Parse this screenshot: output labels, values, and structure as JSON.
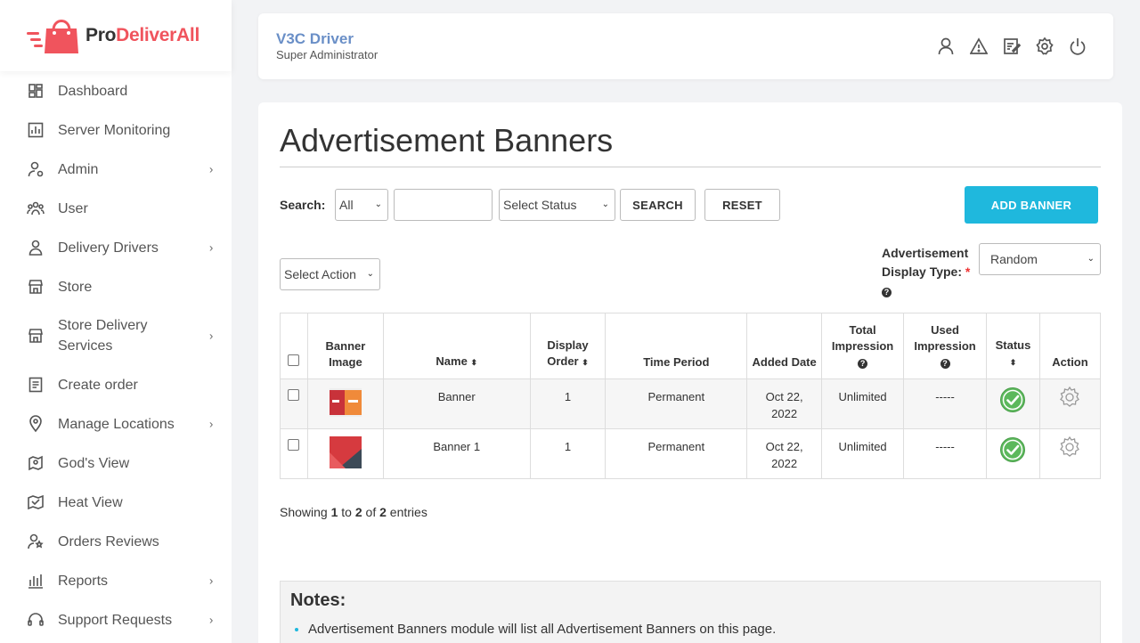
{
  "brand": {
    "part1": "Pro",
    "part2": "DeliverAll"
  },
  "sidebar": {
    "items": [
      {
        "label": "Dashboard",
        "icon": "dashboard-icon",
        "chevron": false
      },
      {
        "label": "Server Monitoring",
        "icon": "chart-icon",
        "chevron": false
      },
      {
        "label": "Admin",
        "icon": "admin-icon",
        "chevron": true
      },
      {
        "label": "User",
        "icon": "users-icon",
        "chevron": false
      },
      {
        "label": "Delivery Drivers",
        "icon": "driver-icon",
        "chevron": true
      },
      {
        "label": "Store",
        "icon": "store-icon",
        "chevron": false
      },
      {
        "label": "Store Delivery Services",
        "icon": "store-icon",
        "chevron": true
      },
      {
        "label": "Create order",
        "icon": "order-icon",
        "chevron": false
      },
      {
        "label": "Manage Locations",
        "icon": "location-icon",
        "chevron": true
      },
      {
        "label": "God's View",
        "icon": "map-pin-icon",
        "chevron": false
      },
      {
        "label": "Heat View",
        "icon": "heat-map-icon",
        "chevron": false
      },
      {
        "label": "Orders Reviews",
        "icon": "review-icon",
        "chevron": false
      },
      {
        "label": "Reports",
        "icon": "bar-chart-icon",
        "chevron": true
      },
      {
        "label": "Support Requests",
        "icon": "headset-icon",
        "chevron": true
      }
    ],
    "chevron_glyph": "›"
  },
  "header": {
    "user_name": "V3C Driver",
    "user_role": "Super Administrator",
    "icons": [
      "profile-icon",
      "warning-icon",
      "edit-icon",
      "settings-icon",
      "power-icon"
    ]
  },
  "page": {
    "title": "Advertisement Banners",
    "search_label": "Search:",
    "search_field_select": "All",
    "search_input": "",
    "status_select": "Select Status",
    "search_button": "SEARCH",
    "reset_button": "RESET",
    "add_button": "ADD BANNER",
    "action_select": "Select Action",
    "display_type_label_1": "Advertisement",
    "display_type_label_2": "Display Type:",
    "required_mark": "*",
    "help_glyph": "?",
    "display_type_value": "Random",
    "caret": "⌄"
  },
  "table": {
    "columns": [
      "Banner Image",
      "Name",
      "Display Order",
      "Time Period",
      "Added Date",
      "Total Impression",
      "Used Impression",
      "Status",
      "Action"
    ],
    "sort_glyph": "⬍",
    "rows": [
      {
        "name": "Banner",
        "order": "1",
        "period": "Permanent",
        "date_1": "Oct 22,",
        "date_2": "2022",
        "total": "Unlimited",
        "used": "-----",
        "status": "active"
      },
      {
        "name": "Banner 1",
        "order": "1",
        "period": "Permanent",
        "date_1": "Oct 22,",
        "date_2": "2022",
        "total": "Unlimited",
        "used": "-----",
        "status": "active"
      }
    ]
  },
  "footer": {
    "showing_1": "Showing ",
    "from": "1",
    "showing_2": " to ",
    "to": "2",
    "showing_3": " of ",
    "total": "2",
    "showing_4": " entries"
  },
  "notes": {
    "title": "Notes:",
    "items": [
      "Advertisement Banners module will list all Advertisement Banners on this page."
    ]
  },
  "colors": {
    "brand_red": "#f0545d",
    "accent": "#1fb8dd",
    "status_green": "#5cb85c"
  }
}
